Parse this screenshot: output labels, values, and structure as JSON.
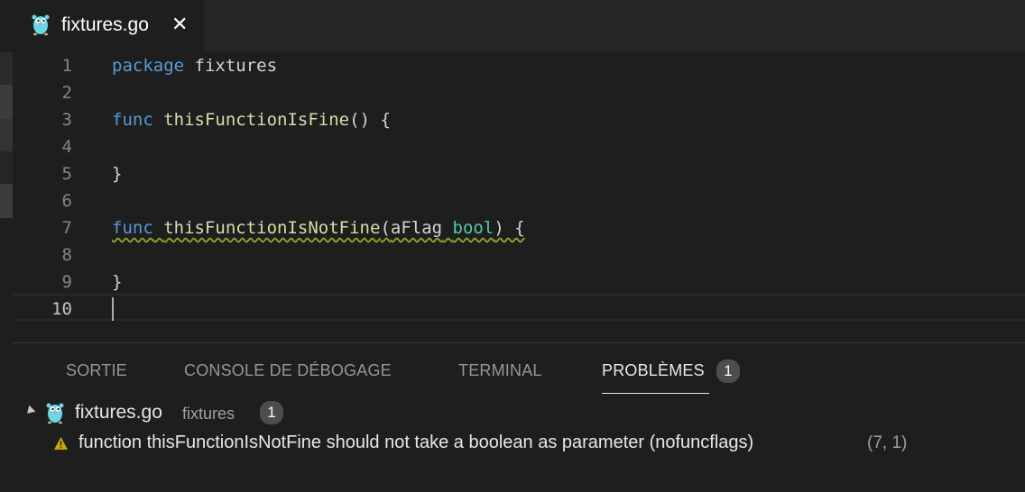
{
  "tab": {
    "filename": "fixtures.go",
    "close_glyph": "✕",
    "icon": "gopher-icon"
  },
  "editor": {
    "lines": [
      {
        "n": "1"
      },
      {
        "n": "2"
      },
      {
        "n": "3"
      },
      {
        "n": "4"
      },
      {
        "n": "5"
      },
      {
        "n": "6"
      },
      {
        "n": "7"
      },
      {
        "n": "8"
      },
      {
        "n": "9"
      },
      {
        "n": "10"
      }
    ],
    "code": {
      "l1_kw": "package",
      "l1_id": "fixtures",
      "l3_kw": "func",
      "l3_fn": "thisFunctionIsFine",
      "l3_rest": "() {",
      "l5": "}",
      "l7_kw": "func",
      "l7_fn": "thisFunctionIsNotFine",
      "l7_paren": "(",
      "l7_param": "aFlag",
      "l7_type": "bool",
      "l7_rest": ") {",
      "l9": "}"
    },
    "colors": {
      "keyword": "#569cd6",
      "function": "#dcdcaa",
      "type": "#4ec9b0",
      "text": "#d4d4d4",
      "squiggle": "#8aa82a"
    }
  },
  "panel": {
    "tabs": [
      {
        "label": "SORTIE"
      },
      {
        "label": "CONSOLE DE DÉBOGAGE"
      },
      {
        "label": "TERMINAL"
      },
      {
        "label": "PROBLÈMES",
        "badge": "1"
      }
    ],
    "file": {
      "name": "fixtures.go",
      "description": "fixtures",
      "count": "1"
    },
    "problem": {
      "icon": "warning-icon",
      "message": "function thisFunctionIsNotFine should not take a boolean as parameter (nofuncflags)",
      "location": "(7, 1)",
      "severity_color": "#cca700"
    }
  }
}
